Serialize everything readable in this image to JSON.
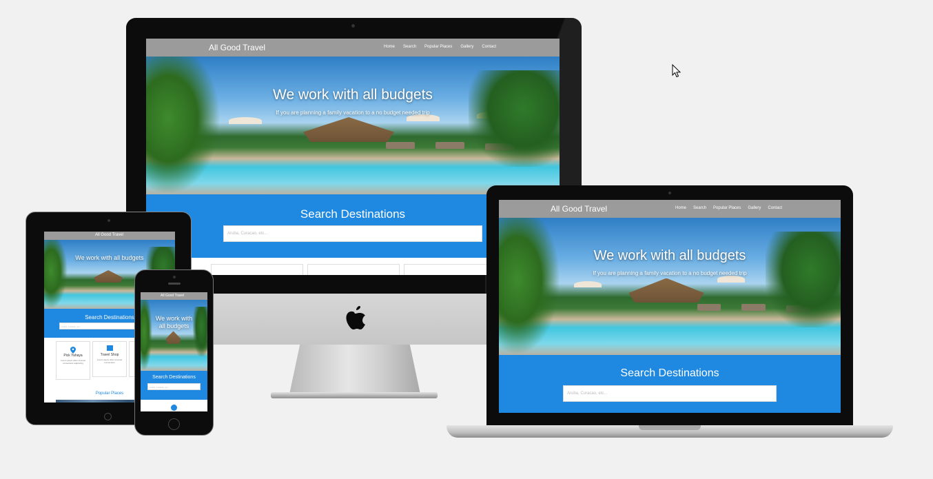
{
  "site": {
    "brand": "All Good Travel",
    "nav": [
      "Home",
      "Search",
      "Popular Places",
      "Gallery",
      "Contact"
    ],
    "hero_title": "We work with all budgets",
    "hero_subtitle": "If you are planning a family vacation to a no budget needed trip",
    "search_title": "Search Destinations",
    "search_placeholder": "Aruba, Curacao, etc...",
    "tablet_title_line1": "We work with all budgets",
    "phone_title_line1": "We work with",
    "phone_title_line2": "all budgets",
    "cards": [
      {
        "title": "Pick Yahaya",
        "text": "Lorem ipsum dolor sit amet consectetur adipiscing"
      },
      {
        "title": "Travel Shop",
        "text": "Lorem ipsum dolor sit amet consectetur"
      }
    ],
    "popular_places": "Popular Places"
  },
  "devices": [
    "desktop-monitor",
    "laptop",
    "tablet",
    "phone"
  ],
  "icons": [
    "apple-logo-icon",
    "cursor-icon",
    "map-pin-icon",
    "shop-icon"
  ],
  "colors": {
    "accent_blue": "#1f88e0",
    "nav_gray": "#9b9b9b",
    "background": "#f1f1f1"
  }
}
